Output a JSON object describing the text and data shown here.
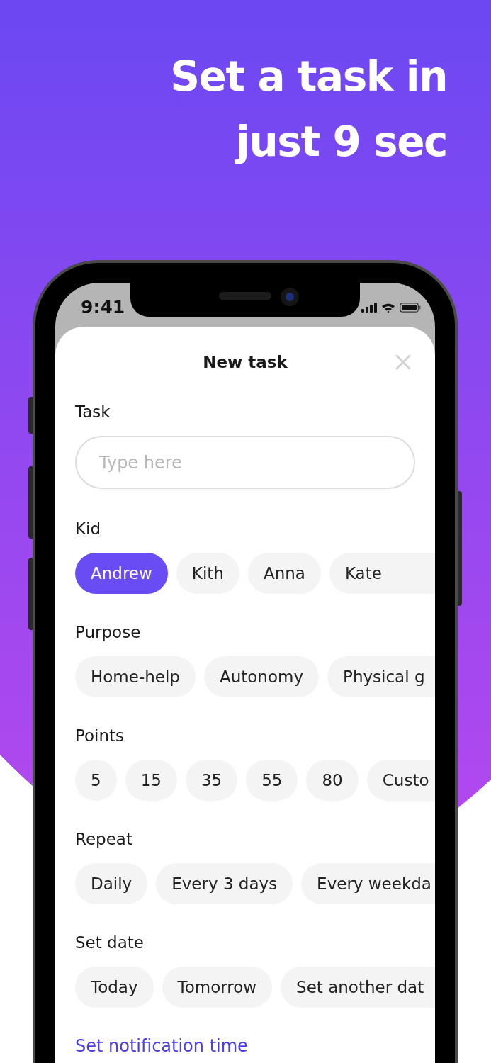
{
  "headline": "Set a task in just 9 sec",
  "status_bar": {
    "time": "9:41"
  },
  "sheet": {
    "title": "New task"
  },
  "sections": [
    {
      "kind": "input",
      "label": "Task",
      "placeholder": "Type here"
    },
    {
      "kind": "chips",
      "label": "Kid",
      "options": [
        {
          "label": "Andrew",
          "selected": true
        },
        {
          "label": "Kith",
          "selected": false
        },
        {
          "label": "Anna",
          "selected": false
        },
        {
          "label": "Kate",
          "selected": false
        }
      ]
    },
    {
      "kind": "chips",
      "label": "Purpose",
      "options": [
        {
          "label": "Home-help",
          "selected": false
        },
        {
          "label": "Autonomy",
          "selected": false
        },
        {
          "label": "Physical g",
          "selected": false
        }
      ]
    },
    {
      "kind": "chips",
      "label": "Points",
      "options": [
        {
          "label": "5",
          "selected": false
        },
        {
          "label": "15",
          "selected": false
        },
        {
          "label": "35",
          "selected": false
        },
        {
          "label": "55",
          "selected": false
        },
        {
          "label": "80",
          "selected": false
        },
        {
          "label": "Custo",
          "selected": false
        }
      ]
    },
    {
      "kind": "chips",
      "label": "Repeat",
      "options": [
        {
          "label": "Daily",
          "selected": false
        },
        {
          "label": "Every 3 days",
          "selected": false
        },
        {
          "label": "Every weekda",
          "selected": false
        }
      ]
    },
    {
      "kind": "chips",
      "label": "Set date",
      "options": [
        {
          "label": "Today",
          "selected": false
        },
        {
          "label": "Tomorrow",
          "selected": false
        },
        {
          "label": "Set another dat",
          "selected": false
        }
      ]
    }
  ],
  "link": "Set notification time"
}
